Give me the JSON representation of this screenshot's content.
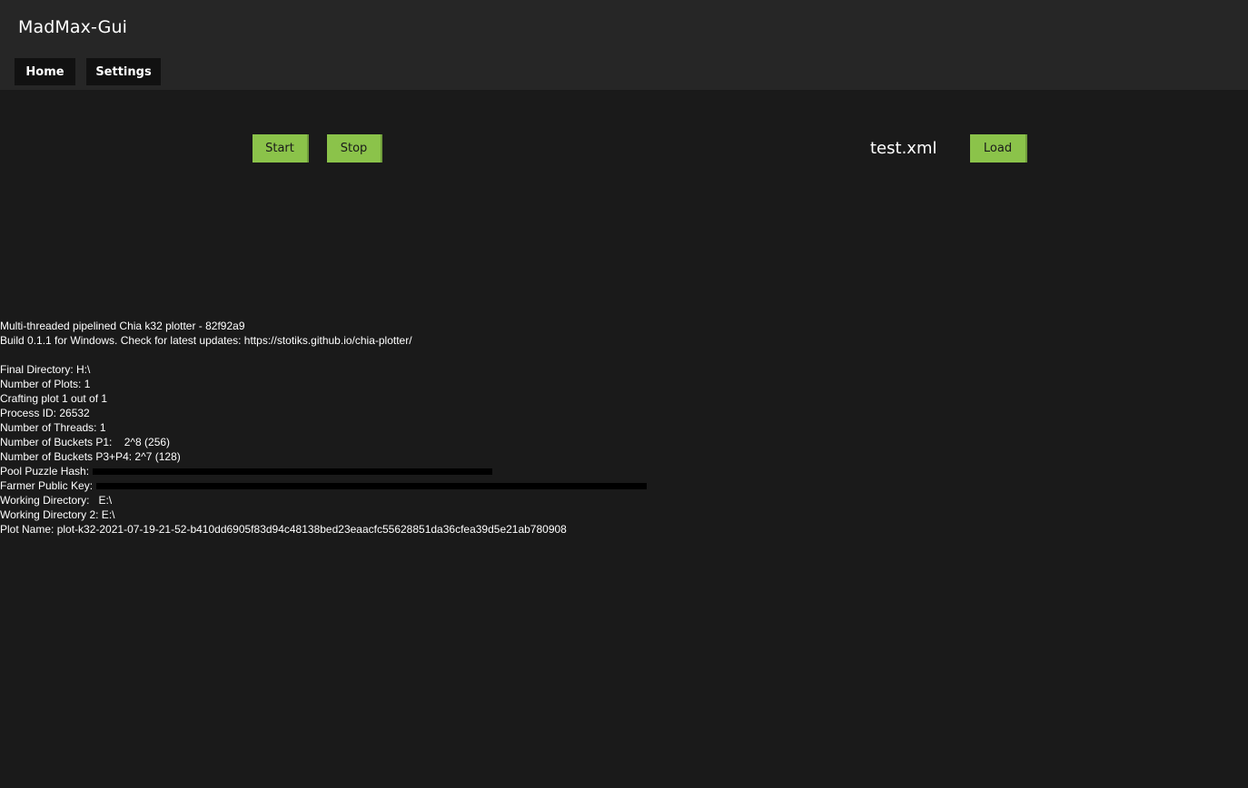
{
  "app": {
    "title": "MadMax-Gui"
  },
  "nav": {
    "home_label": "Home",
    "settings_label": "Settings"
  },
  "controls": {
    "start_label": "Start",
    "stop_label": "Stop",
    "load_label": "Load",
    "config_file": "test.xml"
  },
  "colors": {
    "accent": "#8bc34a",
    "header_bg": "#262626",
    "body_bg": "#1a1a1a"
  },
  "log": {
    "lines": [
      "Multi-threaded pipelined Chia k32 plotter - 82f92a9",
      "Build 0.1.1 for Windows. Check for latest updates: https://stotiks.github.io/chia-plotter/",
      "",
      "Final Directory: H:\\",
      "Number of Plots: 1",
      "Crafting plot 1 out of 1",
      "Process ID: 26532",
      "Number of Threads: 1",
      "Number of Buckets P1:    2^8 (256)",
      "Number of Buckets P3+P4: 2^7 (128)",
      "Pool Puzzle Hash:",
      "Farmer Public Key:",
      "Working Directory:   E:\\",
      "Working Directory 2: E:\\",
      "Plot Name: plot-k32-2021-07-19-21-52-b410dd6905f83d94c48138bed23eaacfc55628851da36cfea39d5e21ab780908"
    ]
  }
}
